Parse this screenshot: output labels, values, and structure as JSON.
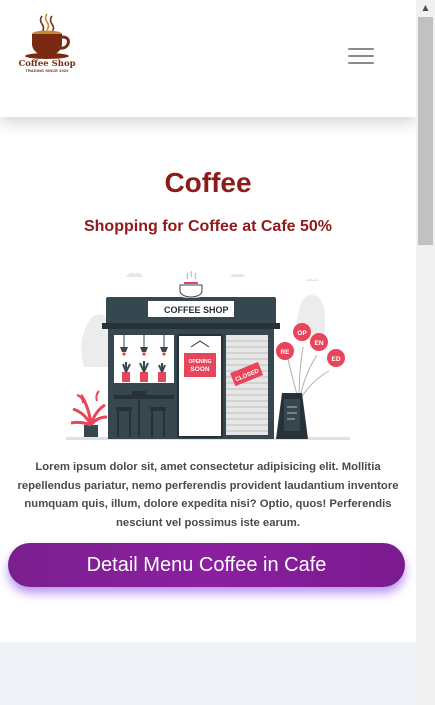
{
  "header": {
    "logo": {
      "name": "Coffee Shop",
      "tagline": "TRADING SINCE 2020",
      "icon": "coffee-cup-icon"
    },
    "menu_icon": "hamburger-menu-icon"
  },
  "hero": {
    "title": "Coffee",
    "subtitle": "Shopping for Coffee at Cafe 50%",
    "illustration": {
      "sign": "COFFEE SHOP",
      "door_sign": "OPENING SOON",
      "closed_sign": "CLOSED",
      "balloons": [
        "RE",
        "OP",
        "EN",
        "ED"
      ]
    },
    "description": "Lorem ipsum dolor sit, amet consectetur adipisicing elit. Mollitia repellendus pariatur, nemo perferendis provident laudantium inventore numquam quis, illum, dolore expedita nisi? Optio, quos! Perferendis nesciunt vel possimus iste earum.",
    "cta_label": "Detail Menu Coffee in Cafe"
  },
  "colors": {
    "accent": "#8e1a1a",
    "button": "#8b1fa0",
    "illustration_red": "#e8455a",
    "illustration_dark": "#37474f"
  },
  "scrollbar": {
    "up_icon": "scroll-up-arrow-icon"
  }
}
